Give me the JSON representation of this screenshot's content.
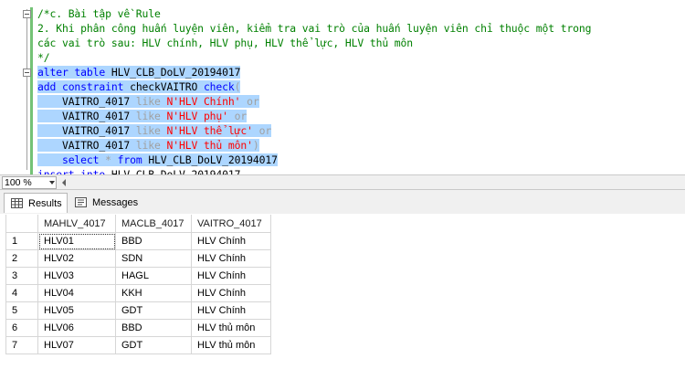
{
  "editor": {
    "lines": [
      {
        "segs": [
          {
            "t": "/*c. Bài tập về Rule",
            "c": "cmt"
          }
        ]
      },
      {
        "segs": [
          {
            "t": "2. Khi phân công huấn luyện viên, kiểm tra vai trò của huấn luyện viên chỉ thuộc một trong",
            "c": "cmt"
          }
        ]
      },
      {
        "segs": [
          {
            "t": "các vai trò sau: HLV chính, HLV phụ, HLV thể lực, HLV thủ môn",
            "c": "cmt"
          }
        ]
      },
      {
        "segs": [
          {
            "t": "*/",
            "c": "cmt"
          }
        ]
      },
      {
        "sel": true,
        "segs": [
          {
            "t": "alter table ",
            "c": "kw"
          },
          {
            "t": "HLV_CLB_DoLV_20194017",
            "c": "id"
          }
        ]
      },
      {
        "sel": true,
        "segs": [
          {
            "t": "add constraint ",
            "c": "kw"
          },
          {
            "t": "checkVAITRO ",
            "c": "id"
          },
          {
            "t": "check",
            "c": "kw"
          },
          {
            "t": "(",
            "c": "gr"
          }
        ]
      },
      {
        "sel": true,
        "segs": [
          {
            "t": "    VAITRO_4017 ",
            "c": "id"
          },
          {
            "t": "like ",
            "c": "gr"
          },
          {
            "t": "N'HLV Chính'",
            "c": "str"
          },
          {
            "t": " or",
            "c": "gr"
          }
        ]
      },
      {
        "sel": true,
        "segs": [
          {
            "t": "    VAITRO_4017 ",
            "c": "id"
          },
          {
            "t": "like ",
            "c": "gr"
          },
          {
            "t": "N'HLV phụ'",
            "c": "str"
          },
          {
            "t": " or",
            "c": "gr"
          }
        ]
      },
      {
        "sel": true,
        "segs": [
          {
            "t": "    VAITRO_4017 ",
            "c": "id"
          },
          {
            "t": "like ",
            "c": "gr"
          },
          {
            "t": "N'HLV thể lực'",
            "c": "str"
          },
          {
            "t": " or",
            "c": "gr"
          }
        ]
      },
      {
        "sel": true,
        "segs": [
          {
            "t": "    VAITRO_4017 ",
            "c": "id"
          },
          {
            "t": "like ",
            "c": "gr"
          },
          {
            "t": "N'HLV thủ môn'",
            "c": "str"
          },
          {
            "t": ")",
            "c": "gr"
          }
        ]
      },
      {
        "sel": true,
        "segs": [
          {
            "t": "    ",
            "c": "id"
          },
          {
            "t": "select ",
            "c": "kw"
          },
          {
            "t": "* ",
            "c": "gr"
          },
          {
            "t": "from ",
            "c": "kw"
          },
          {
            "t": "HLV_CLB_DoLV_20194017",
            "c": "id"
          }
        ]
      },
      {
        "segs": [
          {
            "t": "insert into ",
            "c": "kw"
          },
          {
            "t": "HLV_CLB_DoLV_20194017",
            "c": "id"
          }
        ]
      }
    ]
  },
  "zoom": {
    "value": "100 %"
  },
  "tabs": {
    "results_label": "Results",
    "messages_label": "Messages"
  },
  "grid": {
    "columns": [
      "",
      "MAHLV_4017",
      "MACLB_4017",
      "VAITRO_4017"
    ],
    "rows": [
      [
        "1",
        "HLV01",
        "BBD",
        "HLV Chính"
      ],
      [
        "2",
        "HLV02",
        "SDN",
        "HLV Chính"
      ],
      [
        "3",
        "HLV03",
        "HAGL",
        "HLV Chính"
      ],
      [
        "4",
        "HLV04",
        "KKH",
        "HLV Chính"
      ],
      [
        "5",
        "HLV05",
        "GDT",
        "HLV Chính"
      ],
      [
        "6",
        "HLV06",
        "BBD",
        "HLV thủ môn"
      ],
      [
        "7",
        "HLV07",
        "GDT",
        "HLV thủ môn"
      ]
    ]
  },
  "colors": {
    "selection": "#add6ff",
    "comment": "#008000",
    "keyword": "#0000ff",
    "string": "#ff0000",
    "operator": "#a0a0a0"
  },
  "icons": {
    "results_tab": "grid-icon",
    "messages_tab": "messages-icon",
    "zoom": "chevron-down-icon"
  }
}
